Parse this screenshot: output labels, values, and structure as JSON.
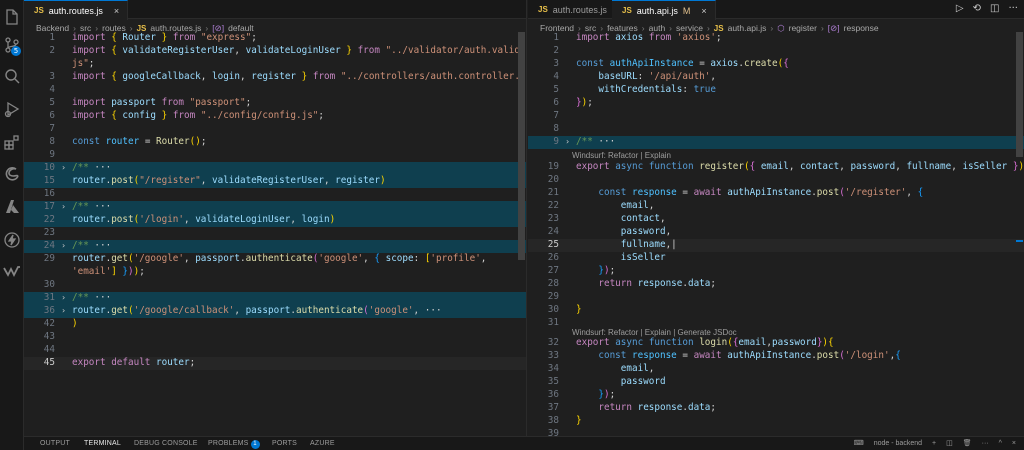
{
  "left": {
    "tabs": [
      {
        "badge": "JS",
        "name": "auth.routes.js",
        "close": "×"
      }
    ],
    "breadcrumb": [
      "Backend",
      "src",
      "routes",
      "auth.routes.js",
      "default"
    ],
    "breadcrumb_file_badge": "JS",
    "lines": {
      "l1": {
        "n": "1",
        "html": "<span class='kw'>import</span> <span class='b1'>{</span> <span class='vr'>Router</span> <span class='b1'>}</span> <span class='kw'>from</span> <span class='st'>\"express\"</span><span class='pn'>;</span>"
      },
      "l2": {
        "n": "2",
        "html": "<span class='kw'>import</span> <span class='b1'>{</span> <span class='vr'>validateRegisterUser</span><span class='pn'>,</span> <span class='vr'>validateLoginUser</span> <span class='b1'>}</span> <span class='kw'>from</span> <span class='st'>\"../validator/auth.validator.</span>"
      },
      "l2b": {
        "n": "",
        "html": "<span class='st'>js\"</span><span class='pn'>;</span>"
      },
      "l3": {
        "n": "3",
        "html": "<span class='kw'>import</span> <span class='b1'>{</span> <span class='vr'>googleCallback</span><span class='pn'>,</span> <span class='vr'>login</span><span class='pn'>,</span> <span class='vr'>register</span> <span class='b1'>}</span> <span class='kw'>from</span> <span class='st'>\"../controllers/auth.controller.js\"</span><span class='pn'>;</span>"
      },
      "l4": {
        "n": "4",
        "html": ""
      },
      "l5": {
        "n": "5",
        "html": "<span class='kw'>import</span> <span class='vr'>passport</span> <span class='kw'>from</span> <span class='st'>\"passport\"</span><span class='pn'>;</span>"
      },
      "l6": {
        "n": "6",
        "html": "<span class='kw'>import</span> <span class='b1'>{</span> <span class='vr'>config</span> <span class='b1'>}</span> <span class='kw'>from</span> <span class='st'>\"../config/config.js\"</span><span class='pn'>;</span>"
      },
      "l7": {
        "n": "7",
        "html": ""
      },
      "l8": {
        "n": "8",
        "html": "<span class='dk'>const</span> <span class='ct'>router</span> <span class='pn'>=</span> <span class='fn'>Router</span><span class='b1'>()</span><span class='pn'>;</span>"
      },
      "l9": {
        "n": "9",
        "html": ""
      },
      "l10": {
        "n": "10",
        "html": "<span class='cm'>/**</span> <span class='pn'>···</span>"
      },
      "l15": {
        "n": "15",
        "html": "<span class='vr'>router</span><span class='pn'>.</span><span class='fn'>post</span><span class='b1'>(</span><span class='st'>\"/register\"</span><span class='pn'>,</span> <span class='vr'>validateRegisterUser</span><span class='pn'>,</span> <span class='vr'>register</span><span class='b1'>)</span>"
      },
      "l16": {
        "n": "16",
        "html": ""
      },
      "l17": {
        "n": "17",
        "html": "<span class='cm'>/**</span> <span class='pn'>···</span>"
      },
      "l22": {
        "n": "22",
        "html": "<span class='vr'>router</span><span class='pn'>.</span><span class='fn'>post</span><span class='b1'>(</span><span class='st'>'/login'</span><span class='pn'>,</span> <span class='vr'>validateLoginUser</span><span class='pn'>,</span> <span class='vr'>login</span><span class='b1'>)</span>"
      },
      "l23": {
        "n": "23",
        "html": ""
      },
      "l24": {
        "n": "24",
        "html": "<span class='cm'>/**</span> <span class='pn'>···</span>"
      },
      "l29": {
        "n": "29",
        "html": "<span class='vr'>router</span><span class='pn'>.</span><span class='fn'>get</span><span class='b1'>(</span><span class='st'>'/google'</span><span class='pn'>,</span> <span class='vr'>passport</span><span class='pn'>.</span><span class='fn'>authenticate</span><span class='b2'>(</span><span class='st'>'google'</span><span class='pn'>,</span> <span class='b3'>{</span> <span class='vr'>scope</span><span class='pn'>:</span> <span class='b1'>[</span><span class='st'>'profile'</span><span class='pn'>,</span>"
      },
      "l29b": {
        "n": "",
        "html": "<span class='st'>'email'</span><span class='b1'>]</span> <span class='b3'>}</span><span class='b2'>)</span><span class='b1'>)</span><span class='pn'>;</span>"
      },
      "l30": {
        "n": "30",
        "html": ""
      },
      "l31": {
        "n": "31",
        "html": "<span class='cm'>/**</span> <span class='pn'>···</span>"
      },
      "l36": {
        "n": "36",
        "html": "<span class='vr'>router</span><span class='pn'>.</span><span class='fn'>get</span><span class='b1'>(</span><span class='st'>'/google/callback'</span><span class='pn'>,</span> <span class='vr'>passport</span><span class='pn'>.</span><span class='fn'>authenticate</span><span class='b2'>(</span><span class='st'>'google'</span><span class='pn'>,</span> <span class='pn'>···</span>"
      },
      "l42": {
        "n": "42",
        "html": "<span class='b1'>)</span>"
      },
      "l43": {
        "n": "43",
        "html": ""
      },
      "l44": {
        "n": "44",
        "html": ""
      },
      "l45": {
        "n": "45",
        "html": "<span class='kw'>export</span> <span class='kw'>default</span> <span class='vr'>router</span><span class='pn'>;</span>"
      }
    }
  },
  "right": {
    "tabs": [
      {
        "badge": "JS",
        "name": "auth.routes.js"
      },
      {
        "badge": "JS",
        "name": "auth.api.js",
        "mod": "M",
        "close": "×"
      }
    ],
    "breadcrumb": [
      "Frontend",
      "src",
      "features",
      "auth",
      "service",
      "auth.api.js",
      "register",
      "response"
    ],
    "breadcrumb_file_badge": "JS",
    "codelens": {
      "register": "Windsurf: Refactor | Explain",
      "login": "Windsurf: Refactor | Explain | Generate JSDoc"
    },
    "lines": {
      "r1": {
        "n": "1",
        "html": "<span class='kw'>import</span> <span class='vr'>axios</span> <span class='kw'>from</span> <span class='st'>'axios'</span><span class='pn'>;</span>"
      },
      "r2": {
        "n": "2",
        "html": ""
      },
      "r3": {
        "n": "3",
        "html": "<span class='dk'>const</span> <span class='ct'>authApiInstance</span> <span class='pn'>=</span> <span class='vr'>axios</span><span class='pn'>.</span><span class='fn'>create</span><span class='b1'>(</span><span class='b2'>{</span>"
      },
      "r4": {
        "n": "4",
        "html": "    <span class='vr'>baseURL</span><span class='pn'>:</span> <span class='st'>'/api/auth'</span><span class='pn'>,</span>"
      },
      "r5": {
        "n": "5",
        "html": "    <span class='vr'>withCredentials</span><span class='pn'>:</span> <span class='dk'>true</span>"
      },
      "r6": {
        "n": "6",
        "html": "<span class='b2'>}</span><span class='b1'>)</span><span class='pn'>;</span>"
      },
      "r7": {
        "n": "7",
        "html": ""
      },
      "r8": {
        "n": "8",
        "html": ""
      },
      "r9": {
        "n": "9",
        "html": "<span class='cm'>/**</span> <span class='pn'>···</span>"
      },
      "r19": {
        "n": "19",
        "html": "<span class='kw'>export</span> <span class='dk'>async</span> <span class='dk'>function</span> <span class='fn'>register</span><span class='b1'>(</span><span class='b2'>{</span> <span class='vr'>email</span><span class='pn'>,</span> <span class='vr'>contact</span><span class='pn'>,</span> <span class='vr'>password</span><span class='pn'>,</span> <span class='vr'>fullname</span><span class='pn'>,</span> <span class='vr'>isSeller</span> <span class='b2'>}</span><span class='b1'>)</span> <span class='b1'>{</span>"
      },
      "r20": {
        "n": "20",
        "html": ""
      },
      "r21": {
        "n": "21",
        "html": "    <span class='dk'>const</span> <span class='ct'>response</span> <span class='pn'>=</span> <span class='kw'>await</span> <span class='vr'>authApiInstance</span><span class='pn'>.</span><span class='fn'>post</span><span class='b2'>(</span><span class='st'>'/register'</span><span class='pn'>,</span> <span class='b3'>{</span>"
      },
      "r22": {
        "n": "22",
        "html": "        <span class='vr'>email</span><span class='pn'>,</span>"
      },
      "r23": {
        "n": "23",
        "html": "        <span class='vr'>contact</span><span class='pn'>,</span>"
      },
      "r24": {
        "n": "24",
        "html": "        <span class='vr'>password</span><span class='pn'>,</span>"
      },
      "r25": {
        "n": "25",
        "html": "        <span class='vr'>fullname</span><span class='pn'>,</span><span class='pn'>|</span>"
      },
      "r26": {
        "n": "26",
        "html": "        <span class='vr'>isSeller</span>"
      },
      "r27": {
        "n": "27",
        "html": "    <span class='b3'>}</span><span class='b2'>)</span><span class='pn'>;</span>"
      },
      "r28": {
        "n": "28",
        "html": "    <span class='kw'>return</span> <span class='vr'>response</span><span class='pn'>.</span><span class='vr'>data</span><span class='pn'>;</span>"
      },
      "r29": {
        "n": "29",
        "html": ""
      },
      "r30": {
        "n": "30",
        "html": "<span class='b1'>}</span>"
      },
      "r31": {
        "n": "31",
        "html": ""
      },
      "r32": {
        "n": "32",
        "html": "<span class='kw'>export</span> <span class='dk'>async</span> <span class='dk'>function</span> <span class='fn'>login</span><span class='b1'>(</span><span class='b2'>{</span><span class='vr'>email</span><span class='pn'>,</span><span class='vr'>password</span><span class='b2'>}</span><span class='b1'>){</span>"
      },
      "r33": {
        "n": "33",
        "html": "    <span class='dk'>const</span> <span class='ct'>response</span> <span class='pn'>=</span> <span class='kw'>await</span> <span class='vr'>authApiInstance</span><span class='pn'>.</span><span class='fn'>post</span><span class='b2'>(</span><span class='st'>'/login'</span><span class='pn'>,</span><span class='b3'>{</span>"
      },
      "r34": {
        "n": "34",
        "html": "        <span class='vr'>email</span><span class='pn'>,</span>"
      },
      "r35": {
        "n": "35",
        "html": "        <span class='vr'>password</span>"
      },
      "r36": {
        "n": "36",
        "html": "    <span class='b3'>}</span><span class='b2'>)</span><span class='pn'>;</span>"
      },
      "r37": {
        "n": "37",
        "html": "    <span class='kw'>return</span> <span class='vr'>response</span><span class='pn'>.</span><span class='vr'>data</span><span class='pn'>;</span>"
      },
      "r38": {
        "n": "38",
        "html": "<span class='b1'>}</span>"
      },
      "r39": {
        "n": "39",
        "html": ""
      }
    }
  },
  "panel": {
    "tabs": [
      "OUTPUT",
      "TERMINAL",
      "DEBUG CONSOLE",
      "PROBLEMS",
      "PORTS",
      "AZURE"
    ],
    "active_tab": "TERMINAL",
    "problems_badge": "1",
    "terminal_name": "node - backend"
  },
  "icons": {
    "activity_bar": [
      "files-icon",
      "source-control-icon",
      "search-icon",
      "run-debug-icon",
      "extensions-icon",
      "edge-icon",
      "azure-icon",
      "thunder-client-icon",
      "windsurf-icon"
    ],
    "source_control_badge": "5"
  },
  "colors": {
    "editor_bg": "#1f1f1f",
    "highlight": "#0f3f4f",
    "accent": "#0078d4",
    "keyword": "#c586c0",
    "string": "#ce9178",
    "function": "#dcdcaa",
    "variable": "#9cdcfe"
  }
}
